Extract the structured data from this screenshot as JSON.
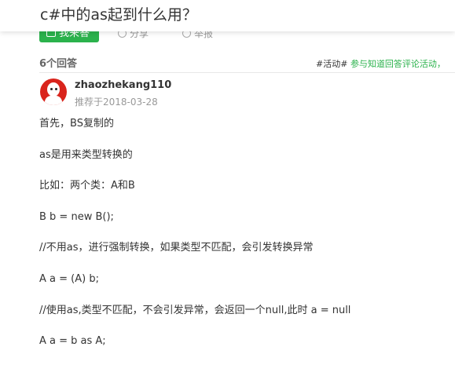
{
  "question": {
    "title": "c#中的as起到什么用？"
  },
  "actions": {
    "answer_label": "我来答",
    "share_label": "分享",
    "report_label": "举报"
  },
  "answers": {
    "count_label": "6个回答",
    "promo_tag": "#活动#",
    "promo_text": "参与知道回答评论活动，"
  },
  "answer": {
    "author": "zhaozhekang110",
    "recommended_date": "推荐于2018-03-28",
    "paragraphs": [
      "首先，BS复制的",
      "as是用来类型转换的",
      "比如：两个类：A和B",
      "B b = new B();",
      "//不用as，进行强制转换，如果类型不匹配，会引发转换异常",
      "A a = (A) b;",
      "//使用as,类型不匹配，不会引发异常，会返回一个null,此时 a = null",
      "A a = b as A;"
    ]
  },
  "colors": {
    "accent": "#2bb24c",
    "avatar_bg": "#d9241c"
  }
}
